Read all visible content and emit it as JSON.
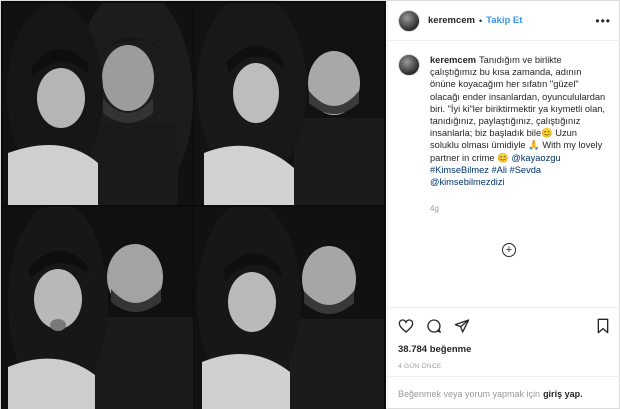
{
  "post": {
    "username": "keremcem",
    "separator": "•",
    "follow_label": "Takip Et",
    "more_icon": "more-horizontal-icon",
    "caption": {
      "username": "keremcem",
      "text_main": "Tanıdığım ve birlikte çalıştığımız bu kısa zamanda, adının önüne koyacağım her sıfatın \"güzel\" olacağı ender insanlardan, oyuncululardan biri. \"İyi ki\"ler biriktirmektir ya kıymetli olan, tanıdığınız, paylaştığınız, çalıştığınız insanlarla; biz başladık bile😊 Uzun soluklu olması ümidiyle 🙏 With my lovely partner in crime 😊 ",
      "mention1": "@kayaozgu",
      "hashtags": "#KimseBilmez #Ali #Sevda",
      "mention2": "@kimsebilmezdizi"
    },
    "time_ago": "4g",
    "load_more_symbol": "+",
    "likes": "38.784 beğenme",
    "date": "4 GÜN ÖNCE",
    "comment_prompt": "Beğenmek veya yorum yapmak için",
    "login_link": "giriş yap.",
    "icons": {
      "like": "heart-icon",
      "comment": "comment-icon",
      "share": "share-icon",
      "save": "bookmark-icon"
    }
  }
}
